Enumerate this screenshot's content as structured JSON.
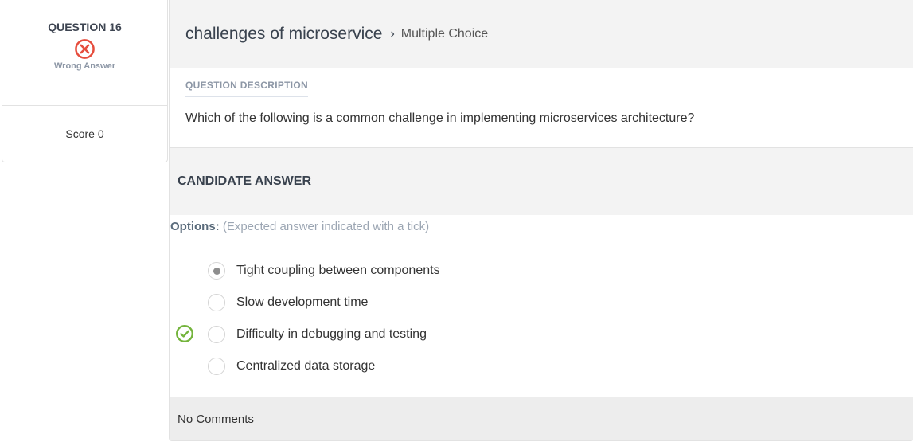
{
  "question": {
    "number_label": "QUESTION 16",
    "status_label": "Wrong Answer",
    "status_icon": "wrong-x-circle-icon",
    "score_label": "Score 0"
  },
  "header": {
    "title": "challenges of microservice",
    "separator": "›",
    "type": "Multiple Choice"
  },
  "description": {
    "heading": "QUESTION DESCRIPTION",
    "text": "Which of the following is a common challenge in implementing microservices architecture?"
  },
  "candidate": {
    "heading": "CANDIDATE ANSWER",
    "options_label": "Options:",
    "options_hint": "(Expected answer indicated with a tick)",
    "options": [
      {
        "label": "Tight coupling between components",
        "selected": true,
        "expected": false
      },
      {
        "label": "Slow development time",
        "selected": false,
        "expected": false
      },
      {
        "label": "Difficulty in debugging and testing",
        "selected": false,
        "expected": true
      },
      {
        "label": "Centralized data storage",
        "selected": false,
        "expected": false
      }
    ]
  },
  "comments": {
    "text": "No Comments"
  },
  "colors": {
    "wrong": "#e64d3d",
    "correct": "#74b43c",
    "header_bg": "#f3f3f3"
  }
}
